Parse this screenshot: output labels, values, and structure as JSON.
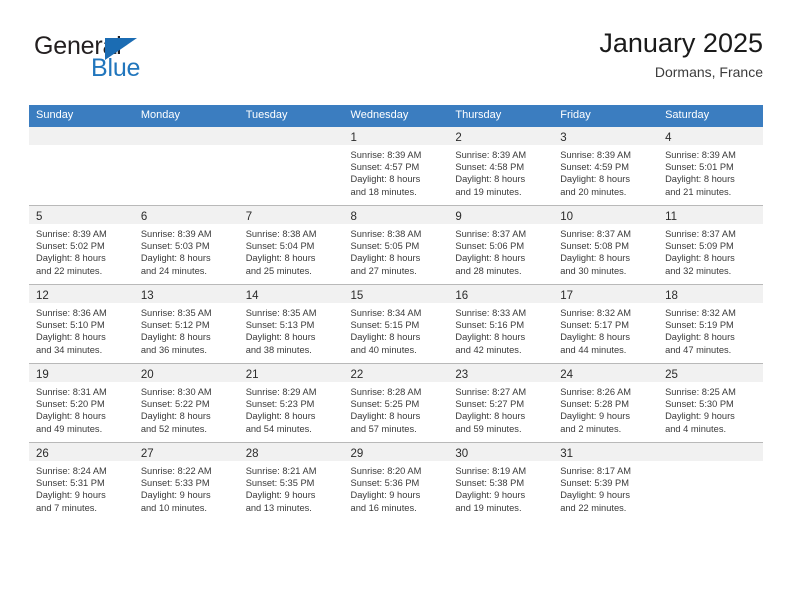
{
  "brand": {
    "name_part1": "General",
    "name_part2": "Blue",
    "logo_icon": "triangle-flag-icon"
  },
  "header": {
    "title": "January 2025",
    "subtitle": "Dormans, France"
  },
  "calendar": {
    "weekday_headers": [
      "Sunday",
      "Monday",
      "Tuesday",
      "Wednesday",
      "Thursday",
      "Friday",
      "Saturday"
    ],
    "accent_color": "#3b7dc0",
    "daynum_band_color": "#f1f1f1",
    "weeks": [
      [
        {
          "empty": true,
          "day": "",
          "sunrise": "",
          "sunset": "",
          "daylight1": "",
          "daylight2": ""
        },
        {
          "empty": true,
          "day": "",
          "sunrise": "",
          "sunset": "",
          "daylight1": "",
          "daylight2": ""
        },
        {
          "empty": true,
          "day": "",
          "sunrise": "",
          "sunset": "",
          "daylight1": "",
          "daylight2": ""
        },
        {
          "empty": false,
          "day": "1",
          "sunrise": "Sunrise: 8:39 AM",
          "sunset": "Sunset: 4:57 PM",
          "daylight1": "Daylight: 8 hours",
          "daylight2": "and 18 minutes."
        },
        {
          "empty": false,
          "day": "2",
          "sunrise": "Sunrise: 8:39 AM",
          "sunset": "Sunset: 4:58 PM",
          "daylight1": "Daylight: 8 hours",
          "daylight2": "and 19 minutes."
        },
        {
          "empty": false,
          "day": "3",
          "sunrise": "Sunrise: 8:39 AM",
          "sunset": "Sunset: 4:59 PM",
          "daylight1": "Daylight: 8 hours",
          "daylight2": "and 20 minutes."
        },
        {
          "empty": false,
          "day": "4",
          "sunrise": "Sunrise: 8:39 AM",
          "sunset": "Sunset: 5:01 PM",
          "daylight1": "Daylight: 8 hours",
          "daylight2": "and 21 minutes."
        }
      ],
      [
        {
          "empty": false,
          "day": "5",
          "sunrise": "Sunrise: 8:39 AM",
          "sunset": "Sunset: 5:02 PM",
          "daylight1": "Daylight: 8 hours",
          "daylight2": "and 22 minutes."
        },
        {
          "empty": false,
          "day": "6",
          "sunrise": "Sunrise: 8:39 AM",
          "sunset": "Sunset: 5:03 PM",
          "daylight1": "Daylight: 8 hours",
          "daylight2": "and 24 minutes."
        },
        {
          "empty": false,
          "day": "7",
          "sunrise": "Sunrise: 8:38 AM",
          "sunset": "Sunset: 5:04 PM",
          "daylight1": "Daylight: 8 hours",
          "daylight2": "and 25 minutes."
        },
        {
          "empty": false,
          "day": "8",
          "sunrise": "Sunrise: 8:38 AM",
          "sunset": "Sunset: 5:05 PM",
          "daylight1": "Daylight: 8 hours",
          "daylight2": "and 27 minutes."
        },
        {
          "empty": false,
          "day": "9",
          "sunrise": "Sunrise: 8:37 AM",
          "sunset": "Sunset: 5:06 PM",
          "daylight1": "Daylight: 8 hours",
          "daylight2": "and 28 minutes."
        },
        {
          "empty": false,
          "day": "10",
          "sunrise": "Sunrise: 8:37 AM",
          "sunset": "Sunset: 5:08 PM",
          "daylight1": "Daylight: 8 hours",
          "daylight2": "and 30 minutes."
        },
        {
          "empty": false,
          "day": "11",
          "sunrise": "Sunrise: 8:37 AM",
          "sunset": "Sunset: 5:09 PM",
          "daylight1": "Daylight: 8 hours",
          "daylight2": "and 32 minutes."
        }
      ],
      [
        {
          "empty": false,
          "day": "12",
          "sunrise": "Sunrise: 8:36 AM",
          "sunset": "Sunset: 5:10 PM",
          "daylight1": "Daylight: 8 hours",
          "daylight2": "and 34 minutes."
        },
        {
          "empty": false,
          "day": "13",
          "sunrise": "Sunrise: 8:35 AM",
          "sunset": "Sunset: 5:12 PM",
          "daylight1": "Daylight: 8 hours",
          "daylight2": "and 36 minutes."
        },
        {
          "empty": false,
          "day": "14",
          "sunrise": "Sunrise: 8:35 AM",
          "sunset": "Sunset: 5:13 PM",
          "daylight1": "Daylight: 8 hours",
          "daylight2": "and 38 minutes."
        },
        {
          "empty": false,
          "day": "15",
          "sunrise": "Sunrise: 8:34 AM",
          "sunset": "Sunset: 5:15 PM",
          "daylight1": "Daylight: 8 hours",
          "daylight2": "and 40 minutes."
        },
        {
          "empty": false,
          "day": "16",
          "sunrise": "Sunrise: 8:33 AM",
          "sunset": "Sunset: 5:16 PM",
          "daylight1": "Daylight: 8 hours",
          "daylight2": "and 42 minutes."
        },
        {
          "empty": false,
          "day": "17",
          "sunrise": "Sunrise: 8:32 AM",
          "sunset": "Sunset: 5:17 PM",
          "daylight1": "Daylight: 8 hours",
          "daylight2": "and 44 minutes."
        },
        {
          "empty": false,
          "day": "18",
          "sunrise": "Sunrise: 8:32 AM",
          "sunset": "Sunset: 5:19 PM",
          "daylight1": "Daylight: 8 hours",
          "daylight2": "and 47 minutes."
        }
      ],
      [
        {
          "empty": false,
          "day": "19",
          "sunrise": "Sunrise: 8:31 AM",
          "sunset": "Sunset: 5:20 PM",
          "daylight1": "Daylight: 8 hours",
          "daylight2": "and 49 minutes."
        },
        {
          "empty": false,
          "day": "20",
          "sunrise": "Sunrise: 8:30 AM",
          "sunset": "Sunset: 5:22 PM",
          "daylight1": "Daylight: 8 hours",
          "daylight2": "and 52 minutes."
        },
        {
          "empty": false,
          "day": "21",
          "sunrise": "Sunrise: 8:29 AM",
          "sunset": "Sunset: 5:23 PM",
          "daylight1": "Daylight: 8 hours",
          "daylight2": "and 54 minutes."
        },
        {
          "empty": false,
          "day": "22",
          "sunrise": "Sunrise: 8:28 AM",
          "sunset": "Sunset: 5:25 PM",
          "daylight1": "Daylight: 8 hours",
          "daylight2": "and 57 minutes."
        },
        {
          "empty": false,
          "day": "23",
          "sunrise": "Sunrise: 8:27 AM",
          "sunset": "Sunset: 5:27 PM",
          "daylight1": "Daylight: 8 hours",
          "daylight2": "and 59 minutes."
        },
        {
          "empty": false,
          "day": "24",
          "sunrise": "Sunrise: 8:26 AM",
          "sunset": "Sunset: 5:28 PM",
          "daylight1": "Daylight: 9 hours",
          "daylight2": "and 2 minutes."
        },
        {
          "empty": false,
          "day": "25",
          "sunrise": "Sunrise: 8:25 AM",
          "sunset": "Sunset: 5:30 PM",
          "daylight1": "Daylight: 9 hours",
          "daylight2": "and 4 minutes."
        }
      ],
      [
        {
          "empty": false,
          "day": "26",
          "sunrise": "Sunrise: 8:24 AM",
          "sunset": "Sunset: 5:31 PM",
          "daylight1": "Daylight: 9 hours",
          "daylight2": "and 7 minutes."
        },
        {
          "empty": false,
          "day": "27",
          "sunrise": "Sunrise: 8:22 AM",
          "sunset": "Sunset: 5:33 PM",
          "daylight1": "Daylight: 9 hours",
          "daylight2": "and 10 minutes."
        },
        {
          "empty": false,
          "day": "28",
          "sunrise": "Sunrise: 8:21 AM",
          "sunset": "Sunset: 5:35 PM",
          "daylight1": "Daylight: 9 hours",
          "daylight2": "and 13 minutes."
        },
        {
          "empty": false,
          "day": "29",
          "sunrise": "Sunrise: 8:20 AM",
          "sunset": "Sunset: 5:36 PM",
          "daylight1": "Daylight: 9 hours",
          "daylight2": "and 16 minutes."
        },
        {
          "empty": false,
          "day": "30",
          "sunrise": "Sunrise: 8:19 AM",
          "sunset": "Sunset: 5:38 PM",
          "daylight1": "Daylight: 9 hours",
          "daylight2": "and 19 minutes."
        },
        {
          "empty": false,
          "day": "31",
          "sunrise": "Sunrise: 8:17 AM",
          "sunset": "Sunset: 5:39 PM",
          "daylight1": "Daylight: 9 hours",
          "daylight2": "and 22 minutes."
        },
        {
          "empty": true,
          "day": "",
          "sunrise": "",
          "sunset": "",
          "daylight1": "",
          "daylight2": ""
        }
      ]
    ]
  }
}
